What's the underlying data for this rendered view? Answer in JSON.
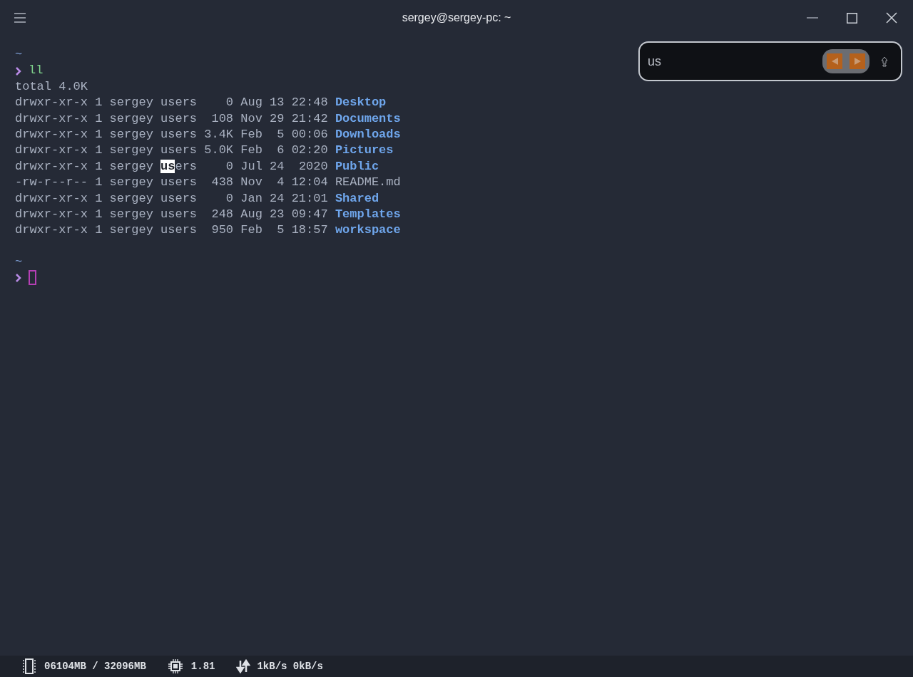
{
  "window": {
    "title": "sergey@sergey-pc: ~"
  },
  "terminal": {
    "blocks": [
      {
        "cwd": "~",
        "command": "ll",
        "output_header": "total 4.0K",
        "rows": [
          {
            "info": [
              {
                "text": "drwxr-xr-x 1 sergey users    0 Aug 13 22:48",
                "highlighted": false
              }
            ],
            "name": "Desktop",
            "kind": "dir"
          },
          {
            "info": [
              {
                "text": "drwxr-xr-x 1 sergey users  108 Nov 29 21:42",
                "highlighted": false
              }
            ],
            "name": "Documents",
            "kind": "dir"
          },
          {
            "info": [
              {
                "text": "drwxr-xr-x 1 sergey users 3.4K Feb  5 00:06",
                "highlighted": false
              }
            ],
            "name": "Downloads",
            "kind": "dir"
          },
          {
            "info": [
              {
                "text": "drwxr-xr-x 1 sergey users 5.0K Feb  6 02:20",
                "highlighted": false
              }
            ],
            "name": "Pictures",
            "kind": "dir"
          },
          {
            "info": [
              {
                "text": "drwxr-xr-x 1 sergey ",
                "highlighted": false
              },
              {
                "text": "us",
                "highlighted": true
              },
              {
                "text": "ers    0 Jul 24  2020",
                "highlighted": false
              }
            ],
            "name": "Public",
            "kind": "dir"
          },
          {
            "info": [
              {
                "text": "-rw-r--r-- 1 sergey users  438 Nov  4 12:04",
                "highlighted": false
              }
            ],
            "name": "README.md",
            "kind": "file"
          },
          {
            "info": [
              {
                "text": "drwxr-xr-x 1 sergey users    0 Jan 24 21:01",
                "highlighted": false
              }
            ],
            "name": "Shared",
            "kind": "dir"
          },
          {
            "info": [
              {
                "text": "drwxr-xr-x 1 sergey users  248 Aug 23 09:47",
                "highlighted": false
              }
            ],
            "name": "Templates",
            "kind": "dir"
          },
          {
            "info": [
              {
                "text": "drwxr-xr-x 1 sergey users  950 Feb  5 18:57",
                "highlighted": false
              }
            ],
            "name": "workspace",
            "kind": "dir"
          }
        ]
      },
      {
        "cwd": "~",
        "cursor": true
      }
    ]
  },
  "search": {
    "value": "us"
  },
  "status_bar": {
    "memory": "06104MB / 32096MB",
    "load": "1.81",
    "network": "1kB/s 0kB/s"
  }
}
